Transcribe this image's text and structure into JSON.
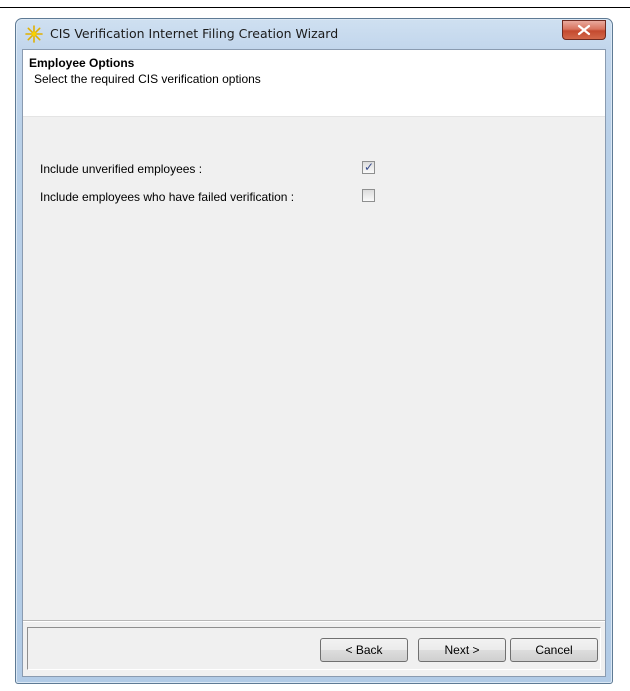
{
  "window": {
    "title": "CIS Verification Internet Filing Creation Wizard",
    "close_symbol": "✕"
  },
  "header": {
    "title": "Employee Options",
    "subtitle": "Select the required CIS verification options"
  },
  "options": [
    {
      "label": "Include unverified employees :",
      "checked": true
    },
    {
      "label": "Include employees who have failed verification :",
      "checked": false
    }
  ],
  "buttons": {
    "back": "< Back",
    "next": "Next >",
    "cancel": "Cancel"
  },
  "icons": {
    "app": "sparkle-star-icon",
    "close": "close-icon",
    "check": "checkmark-icon"
  },
  "colors": {
    "close_button": "#c44a2f",
    "app_icon": "#f2c200"
  }
}
